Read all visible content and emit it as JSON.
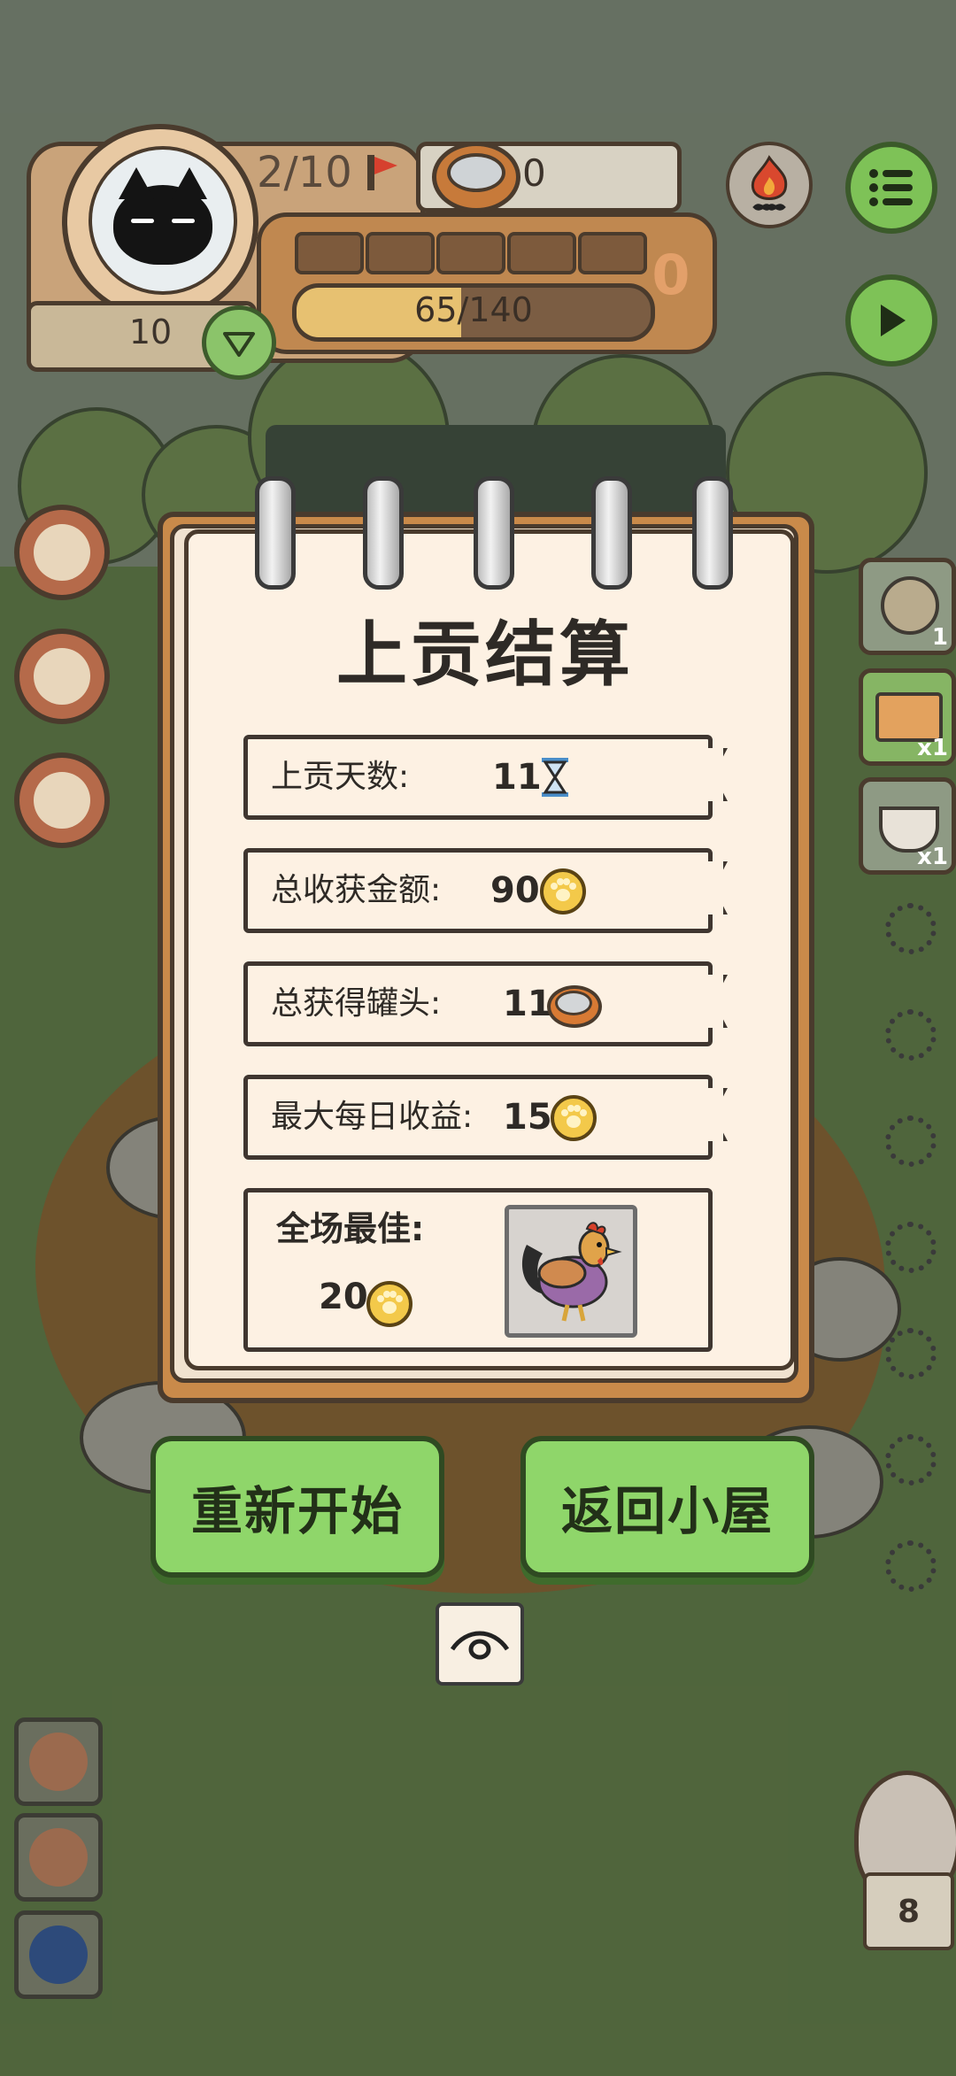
{
  "hud": {
    "level": "2/10",
    "cans": "0",
    "xp_text": "65/140",
    "xp_progress": 0.464,
    "coins": "10",
    "bonus": "0",
    "segments_filled": 0,
    "segments_total": 5
  },
  "dialog": {
    "title": "上贡结算",
    "rows": [
      {
        "label": "上贡天数:",
        "value": "11",
        "icon": "hourglass-icon"
      },
      {
        "label": "总收获金额:",
        "value": "90",
        "icon": "paw-coin-icon"
      },
      {
        "label": "总获得罐头:",
        "value": "11",
        "icon": "can-icon"
      },
      {
        "label": "最大每日收益:",
        "value": "15",
        "icon": "paw-coin-icon"
      }
    ],
    "best": {
      "label": "全场最佳:",
      "value": "20",
      "icon": "paw-coin-icon",
      "animal": "rooster"
    }
  },
  "buttons": {
    "restart": "重新开始",
    "back_home": "返回小屋"
  },
  "side_right": [
    {
      "icon": "stone-bag-icon",
      "count": "1"
    },
    {
      "icon": "ticket-icon",
      "count": "x1"
    },
    {
      "icon": "bowl-icon",
      "count": "x1"
    }
  ],
  "owl_count": "8",
  "colors": {
    "button_green": "#8fd66a",
    "paper": "#fdf1e3",
    "outline": "#3f3630",
    "coin_gold": "#f3c94a"
  }
}
